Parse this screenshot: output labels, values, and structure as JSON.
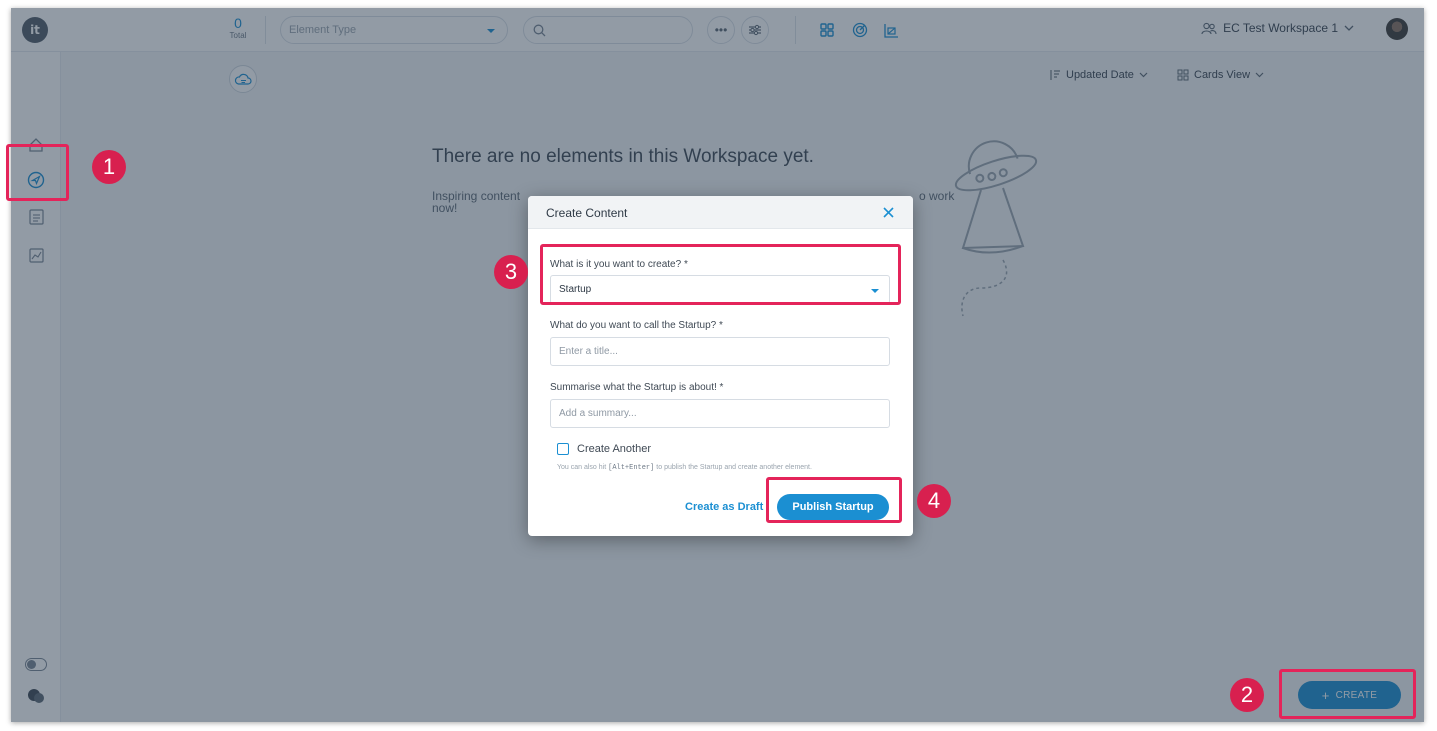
{
  "topbar": {
    "logo_text": "it",
    "total_count": "0",
    "total_label": "Total",
    "element_type_placeholder": "Element Type",
    "search_placeholder": "",
    "more_label": "•••",
    "workspace_name": "EC Test Workspace 1"
  },
  "toolbar": {
    "sort_label": "Updated Date",
    "view_label": "Cards View"
  },
  "empty_state": {
    "title": "There are no elements in this Workspace yet.",
    "text_left": "Inspiring content",
    "text_right": "o work",
    "text_line2": "now!"
  },
  "create_button": {
    "icon": "+",
    "label": "CREATE"
  },
  "dialog": {
    "title": "Create Content",
    "type_label": "What is it you want to create? *",
    "type_value": "Startup",
    "name_label": "What do you want to call the Startup? *",
    "name_placeholder": "Enter a title...",
    "summary_label": "Summarise what the Startup is about! *",
    "summary_placeholder": "Add a summary...",
    "create_another_label": "Create Another",
    "hint_prefix": "You can also hit ",
    "hint_shortcut": "[Alt+Enter]",
    "hint_suffix": " to publish the Startup and create another element.",
    "draft_label": "Create as Draft",
    "publish_label": "Publish Startup"
  },
  "markers": [
    "1",
    "2",
    "3",
    "4"
  ],
  "colors": {
    "accent": "#1b8fd2",
    "highlight": "#e4245a",
    "marker": "#d8204f",
    "overlay": "rgba(38,55,76,0.50)"
  },
  "icons": [
    "home-icon",
    "explore-icon",
    "list-icon",
    "chart-icon",
    "search-icon",
    "filter-icon",
    "grid-icon",
    "radar-icon",
    "analytics-icon",
    "workspace-icon",
    "close-icon",
    "toggle-icon",
    "chat-icon",
    "ufo-illustration"
  ]
}
